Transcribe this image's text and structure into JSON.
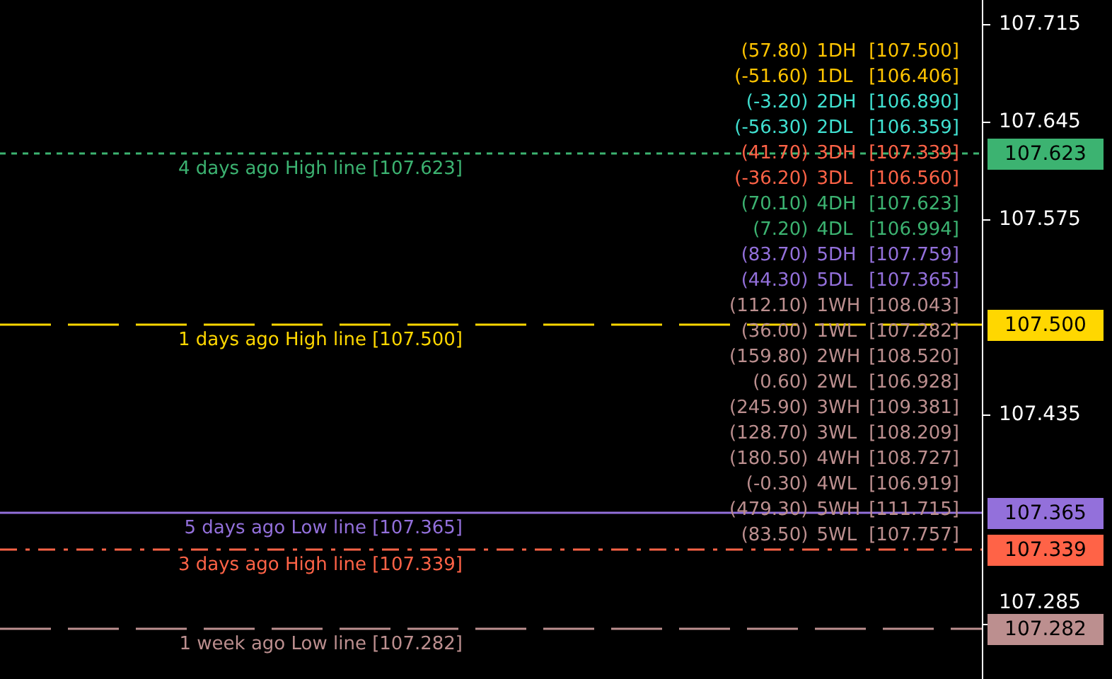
{
  "levels": [
    {
      "label": "4 days ago High line [107.623]",
      "tag": "107.623",
      "color": "#3cb371",
      "kind": "dot"
    },
    {
      "label": "1 days ago High line [107.500]",
      "tag": "107.500",
      "color": "#ffd700",
      "kind": "longdash"
    },
    {
      "label": "5 days ago Low line [107.365]",
      "tag": "107.365",
      "color": "#9370db",
      "kind": "solid"
    },
    {
      "label": "3 days ago High line [107.339]",
      "tag": "107.339",
      "color": "#ff6347",
      "kind": "dashdot"
    },
    {
      "label": "1 week ago Low line [107.282]",
      "tag": "107.282",
      "color": "#bc8f8f",
      "kind": "longdash"
    }
  ],
  "stats": [
    {
      "change": "(57.80)",
      "name": "1DH",
      "value": "[107.500]",
      "color": "#ffc400"
    },
    {
      "change": "(-51.60)",
      "name": "1DL",
      "value": "[106.406]",
      "color": "#ffc400"
    },
    {
      "change": "(-3.20)",
      "name": "2DH",
      "value": "[106.890]",
      "color": "#40e0d0"
    },
    {
      "change": "(-56.30)",
      "name": "2DL",
      "value": "[106.359]",
      "color": "#40e0d0"
    },
    {
      "change": "(41.70)",
      "name": "3DH",
      "value": "[107.339]",
      "color": "#ff6347"
    },
    {
      "change": "(-36.20)",
      "name": "3DL",
      "value": "[106.560]",
      "color": "#ff6347"
    },
    {
      "change": "(70.10)",
      "name": "4DH",
      "value": "[107.623]",
      "color": "#3cb371"
    },
    {
      "change": "(7.20)",
      "name": "4DL",
      "value": "[106.994]",
      "color": "#3cb371"
    },
    {
      "change": "(83.70)",
      "name": "5DH",
      "value": "[107.759]",
      "color": "#9370db"
    },
    {
      "change": "(44.30)",
      "name": "5DL",
      "value": "[107.365]",
      "color": "#9370db"
    },
    {
      "change": "(112.10)",
      "name": "1WH",
      "value": "[108.043]",
      "color": "#bc8f8f"
    },
    {
      "change": "(36.00)",
      "name": "1WL",
      "value": "[107.282]",
      "color": "#bc8f8f"
    },
    {
      "change": "(159.80)",
      "name": "2WH",
      "value": "[108.520]",
      "color": "#bc8f8f"
    },
    {
      "change": "(0.60)",
      "name": "2WL",
      "value": "[106.928]",
      "color": "#bc8f8f"
    },
    {
      "change": "(245.90)",
      "name": "3WH",
      "value": "[109.381]",
      "color": "#bc8f8f"
    },
    {
      "change": "(128.70)",
      "name": "3WL",
      "value": "[108.209]",
      "color": "#bc8f8f"
    },
    {
      "change": "(180.50)",
      "name": "4WH",
      "value": "[108.727]",
      "color": "#bc8f8f"
    },
    {
      "change": "(-0.30)",
      "name": "4WL",
      "value": "[106.919]",
      "color": "#bc8f8f"
    },
    {
      "change": "(479.30)",
      "name": "5WH",
      "value": "[111.715]",
      "color": "#bc8f8f"
    },
    {
      "change": "(83.50)",
      "name": "5WL",
      "value": "[107.757]",
      "color": "#bc8f8f"
    }
  ],
  "price_axis": {
    "ticks": [
      "107.715",
      "107.645",
      "107.575",
      "107.435",
      "107.285"
    ]
  }
}
